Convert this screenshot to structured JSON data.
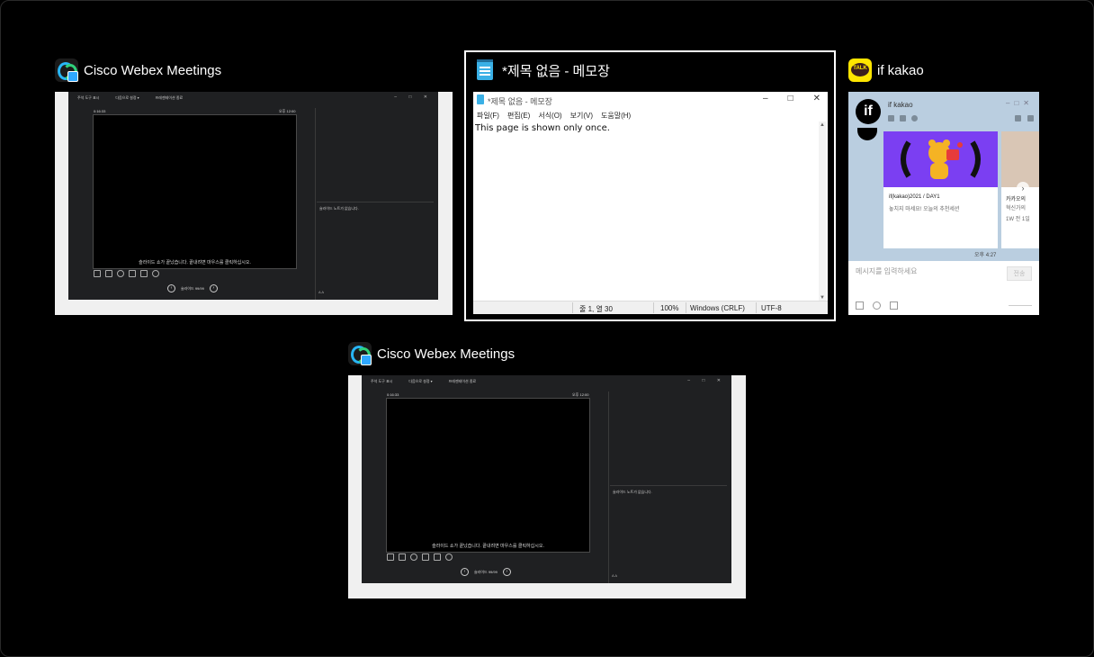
{
  "switcher": {
    "windows": [
      {
        "app": "Cisco Webex Meetings",
        "icon": "webex-icon",
        "content": {
          "toolbar": [
            "주석 도구 표시",
            "다음으로 설정 ▾",
            "프레젠테이션 종료"
          ],
          "elapsed": "0:16:33",
          "clock": "오후 12:00",
          "stage_caption": "슬라이드 쇼가 끝났습니다. 끝내려면 마우스를 클릭하십시오.",
          "notes": "슬라이드 노트가 없습니다.",
          "pager": "슬라이드 99/99"
        }
      },
      {
        "app": "*제목 없음 - 메모장",
        "icon": "notepad-icon",
        "selected": true,
        "content": {
          "window_title": "*제목 없음 - 메모장",
          "menu": [
            "파일(F)",
            "편집(E)",
            "서식(O)",
            "보기(V)",
            "도움말(H)"
          ],
          "text": "This page is shown only once.",
          "status": {
            "position": "줄 1, 열 30",
            "zoom": "100%",
            "line_ending": "Windows (CRLF)",
            "encoding": "UTF-8"
          }
        }
      },
      {
        "app": "if kakao",
        "icon": "kakao-icon",
        "content": {
          "channel_name": "if kakao",
          "logo_text": "if",
          "card1_title": "if(kakao)2021 / DAY1",
          "card1_sub": "놓치지 마세요! 오늘의 추천세션",
          "card2_title": "카카오의",
          "card2_sub": "혁신가의",
          "card2_meta": "1W 전 1일",
          "time": "오후 4:27",
          "input_placeholder": "메시지를 입력하세요",
          "send_label": "전송"
        }
      },
      {
        "app": "Cisco Webex Meetings",
        "icon": "webex-icon"
      }
    ]
  }
}
